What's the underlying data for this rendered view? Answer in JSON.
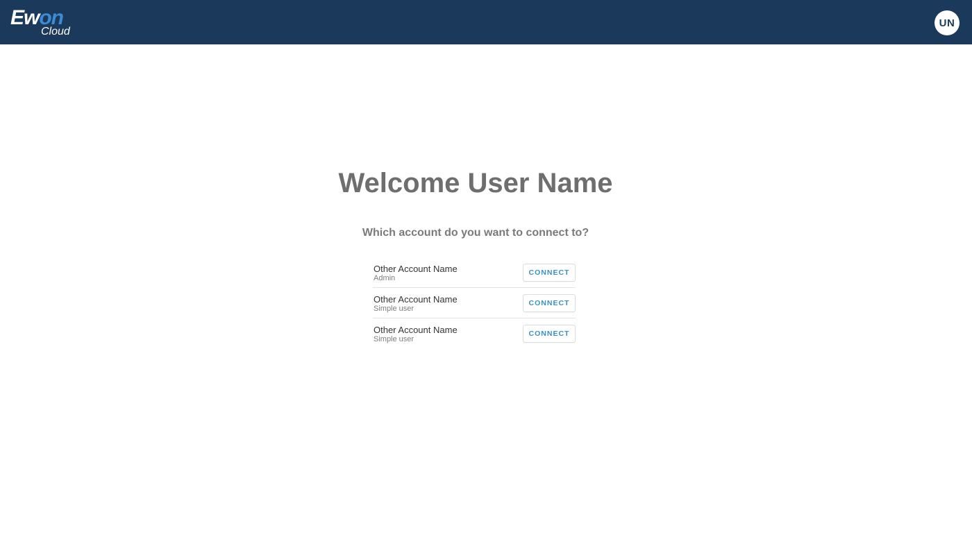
{
  "header": {
    "logo_main_prefix": "Ew",
    "logo_main_highlight": "on",
    "logo_sub": "Cloud",
    "avatar_initials": "UN",
    "colors": {
      "background": "#1b3a5b",
      "logo_accent": "#3d8bd4"
    }
  },
  "main": {
    "welcome_title": "Welcome User Name",
    "question": "Which account do you want to connect to?",
    "accounts": [
      {
        "name": "Other Account Name",
        "role": "Admin",
        "button_label": "CONNECT"
      },
      {
        "name": "Other Account Name",
        "role": "Simple user",
        "button_label": "CONNECT"
      },
      {
        "name": "Other Account Name",
        "role": "Simple user",
        "button_label": "CONNECT"
      }
    ],
    "colors": {
      "connect_text": "#3b8fc9",
      "title_text": "#6e6e6e"
    }
  }
}
